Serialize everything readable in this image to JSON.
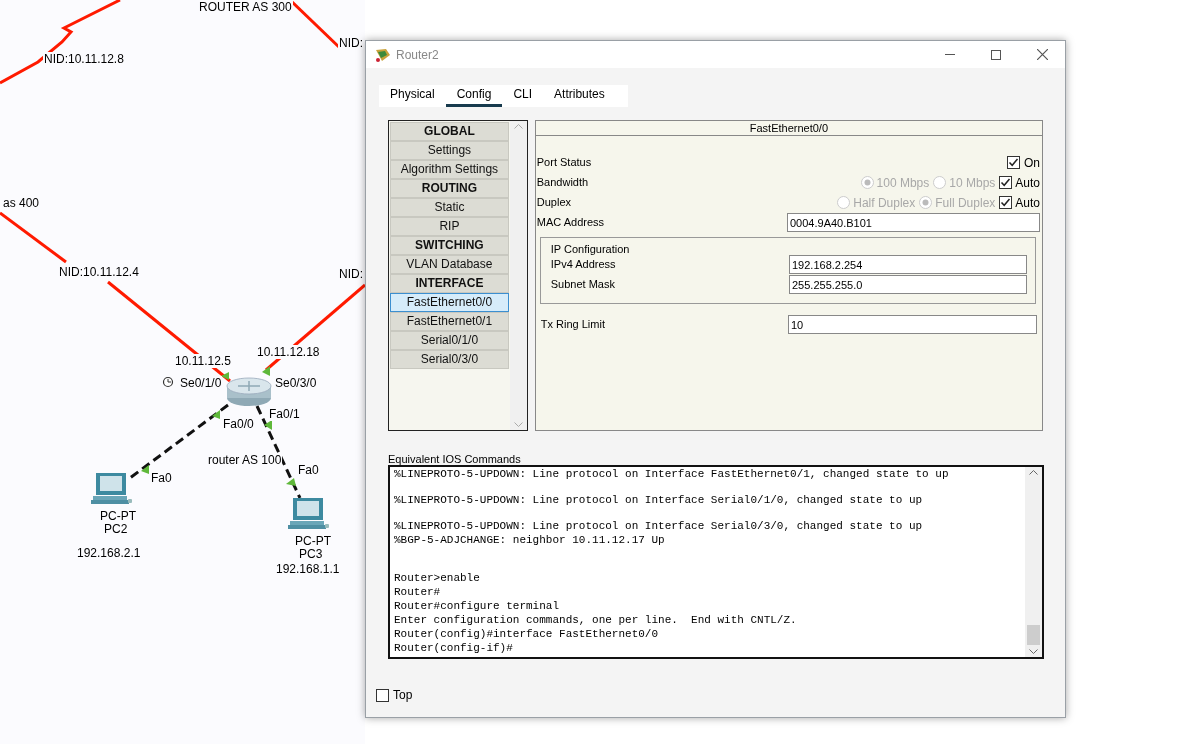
{
  "canvas": {
    "labels": [
      {
        "text": "ROUTER AS 300"
      },
      {
        "text": "NID:10.11.12.8"
      },
      {
        "text": "NID:"
      },
      {
        "text": "as 400"
      },
      {
        "text": "NID:10.11.12.4"
      },
      {
        "text": "NID:"
      },
      {
        "text": "10.11.12.5"
      },
      {
        "text": "10.11.12.18"
      },
      {
        "text": "Se0/1/0"
      },
      {
        "text": "Se0/3/0"
      },
      {
        "text": "Fa0/1"
      },
      {
        "text": "Fa0/0"
      },
      {
        "text": "router AS 100"
      },
      {
        "text": "Fa0"
      },
      {
        "text": "Fa0"
      },
      {
        "text": "192.168.2.1"
      },
      {
        "text": "192.168.1.1"
      }
    ],
    "devices": [
      {
        "kind": "router"
      },
      {
        "kind": "pc",
        "type_label": "PC-PT",
        "name": "PC2"
      },
      {
        "kind": "pc",
        "type_label": "PC-PT",
        "name": "PC3"
      }
    ]
  },
  "window": {
    "title": "Router2",
    "tabs": [
      {
        "label": "Physical",
        "selected": false
      },
      {
        "label": "Config",
        "selected": true
      },
      {
        "label": "CLI",
        "selected": false
      },
      {
        "label": "Attributes",
        "selected": false
      }
    ],
    "sidebar": {
      "items": [
        {
          "label": "GLOBAL",
          "kind": "header"
        },
        {
          "label": "Settings",
          "kind": "item",
          "selected": false
        },
        {
          "label": "Algorithm Settings",
          "kind": "item",
          "selected": false
        },
        {
          "label": "ROUTING",
          "kind": "header"
        },
        {
          "label": "Static",
          "kind": "item",
          "selected": false
        },
        {
          "label": "RIP",
          "kind": "item",
          "selected": false
        },
        {
          "label": "SWITCHING",
          "kind": "header"
        },
        {
          "label": "VLAN Database",
          "kind": "item",
          "selected": false
        },
        {
          "label": "INTERFACE",
          "kind": "header"
        },
        {
          "label": "FastEthernet0/0",
          "kind": "item",
          "selected": true
        },
        {
          "label": "FastEthernet0/1",
          "kind": "item",
          "selected": false
        },
        {
          "label": "Serial0/1/0",
          "kind": "item",
          "selected": false
        },
        {
          "label": "Serial0/3/0",
          "kind": "item",
          "selected": false
        }
      ]
    },
    "panel": {
      "title": "FastEthernet0/0",
      "port_status": {
        "label": "Port Status",
        "checkbox": {
          "label": "On",
          "checked": true
        }
      },
      "bandwidth": {
        "label": "Bandwidth",
        "options": [
          {
            "label": "100 Mbps",
            "selected": true
          },
          {
            "label": "10 Mbps",
            "selected": false
          }
        ],
        "disabled": true,
        "auto": {
          "label": "Auto",
          "checked": true
        }
      },
      "duplex": {
        "label": "Duplex",
        "options": [
          {
            "label": "Half Duplex",
            "selected": false
          },
          {
            "label": "Full Duplex",
            "selected": true
          }
        ],
        "disabled": true,
        "auto": {
          "label": "Auto",
          "checked": true
        }
      },
      "mac_address": {
        "label": "MAC Address",
        "value": "0004.9A40.B101"
      },
      "ip_configuration": {
        "title": "IP Configuration",
        "ipv4_address": {
          "label": "IPv4 Address",
          "value": "192.168.2.254"
        },
        "subnet_mask": {
          "label": "Subnet Mask",
          "value": "255.255.255.0"
        }
      },
      "tx_ring_limit": {
        "label": "Tx Ring Limit",
        "value": "10"
      }
    },
    "console": {
      "label": "Equivalent IOS Commands",
      "blocks": [
        [
          "%LINEPROTO-5-UPDOWN: Line protocol on Interface FastEthernet0/1, changed state to up"
        ],
        [
          "%LINEPROTO-5-UPDOWN: Line protocol on Interface Serial0/1/0, changed state to up"
        ],
        [
          "%LINEPROTO-5-UPDOWN: Line protocol on Interface Serial0/3/0, changed state to up",
          "%BGP-5-ADJCHANGE: neighbor 10.11.12.17 Up"
        ],
        [
          "Router>enable",
          "Router#",
          "Router#configure terminal",
          "Enter configuration commands, one per line.  End with CNTL/Z.",
          "Router(config)#interface FastEthernet0/0",
          "Router(config-if)#"
        ]
      ]
    },
    "top_checkbox": {
      "label": "Top",
      "checked": false
    }
  }
}
